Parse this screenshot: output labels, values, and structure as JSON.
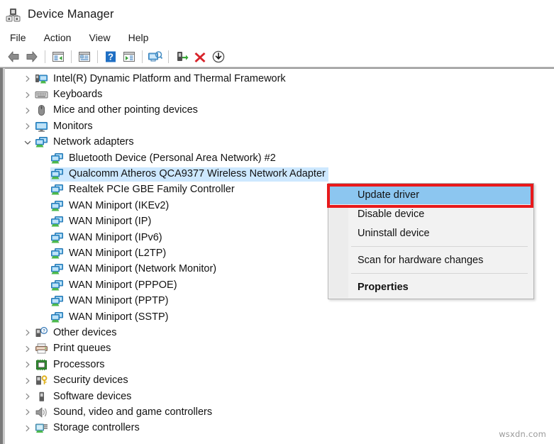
{
  "window": {
    "title": "Device Manager",
    "app_icon": "device-manager-icon"
  },
  "menubar": {
    "items": [
      {
        "label": "File",
        "name": "menu-file"
      },
      {
        "label": "Action",
        "name": "menu-action"
      },
      {
        "label": "View",
        "name": "menu-view"
      },
      {
        "label": "Help",
        "name": "menu-help"
      }
    ]
  },
  "toolbar": {
    "buttons": [
      {
        "icon": "back-arrow-icon",
        "title": "Back"
      },
      {
        "icon": "forward-arrow-icon",
        "title": "Forward"
      },
      {
        "icon": "up-one-level-icon",
        "title": "Up one level"
      },
      {
        "icon": "properties-icon",
        "title": "Properties"
      },
      {
        "icon": "help-icon",
        "title": "Help"
      },
      {
        "icon": "show-hidden-devices-icon",
        "title": "Show hidden devices"
      },
      {
        "icon": "scan-hardware-changes-icon",
        "title": "Scan for hardware changes"
      },
      {
        "icon": "enable-device-icon",
        "title": "Enable device"
      },
      {
        "icon": "uninstall-device-icon",
        "title": "Uninstall device"
      },
      {
        "icon": "update-driver-icon",
        "title": "Update driver"
      }
    ]
  },
  "tree": {
    "rows": [
      {
        "label": "Intel(R) Dynamic Platform and Thermal Framework",
        "level": 1,
        "chevron": "collapsed",
        "icon": "system-device-icon",
        "selected": false
      },
      {
        "label": "Keyboards",
        "level": 1,
        "chevron": "collapsed",
        "icon": "keyboard-icon",
        "selected": false
      },
      {
        "label": "Mice and other pointing devices",
        "level": 1,
        "chevron": "collapsed",
        "icon": "mouse-icon",
        "selected": false
      },
      {
        "label": "Monitors",
        "level": 1,
        "chevron": "collapsed",
        "icon": "monitor-icon",
        "selected": false
      },
      {
        "label": "Network adapters",
        "level": 1,
        "chevron": "expanded",
        "icon": "network-adapter-icon",
        "selected": false
      },
      {
        "label": "Bluetooth Device (Personal Area Network) #2",
        "level": 2,
        "chevron": "none",
        "icon": "network-adapter-icon",
        "selected": false
      },
      {
        "label": "Qualcomm Atheros QCA9377 Wireless Network Adapter",
        "level": 2,
        "chevron": "none",
        "icon": "network-adapter-icon",
        "selected": true
      },
      {
        "label": "Realtek PCIe GBE Family Controller",
        "level": 2,
        "chevron": "none",
        "icon": "network-adapter-icon",
        "selected": false
      },
      {
        "label": "WAN Miniport (IKEv2)",
        "level": 2,
        "chevron": "none",
        "icon": "network-adapter-icon",
        "selected": false
      },
      {
        "label": "WAN Miniport (IP)",
        "level": 2,
        "chevron": "none",
        "icon": "network-adapter-icon",
        "selected": false
      },
      {
        "label": "WAN Miniport (IPv6)",
        "level": 2,
        "chevron": "none",
        "icon": "network-adapter-icon",
        "selected": false
      },
      {
        "label": "WAN Miniport (L2TP)",
        "level": 2,
        "chevron": "none",
        "icon": "network-adapter-icon",
        "selected": false
      },
      {
        "label": "WAN Miniport (Network Monitor)",
        "level": 2,
        "chevron": "none",
        "icon": "network-adapter-icon",
        "selected": false
      },
      {
        "label": "WAN Miniport (PPPOE)",
        "level": 2,
        "chevron": "none",
        "icon": "network-adapter-icon",
        "selected": false
      },
      {
        "label": "WAN Miniport (PPTP)",
        "level": 2,
        "chevron": "none",
        "icon": "network-adapter-icon",
        "selected": false
      },
      {
        "label": "WAN Miniport (SSTP)",
        "level": 2,
        "chevron": "none",
        "icon": "network-adapter-icon",
        "selected": false
      },
      {
        "label": "Other devices",
        "level": 1,
        "chevron": "collapsed",
        "icon": "unknown-device-icon",
        "selected": false
      },
      {
        "label": "Print queues",
        "level": 1,
        "chevron": "collapsed",
        "icon": "printer-icon",
        "selected": false
      },
      {
        "label": "Processors",
        "level": 1,
        "chevron": "collapsed",
        "icon": "processor-icon",
        "selected": false
      },
      {
        "label": "Security devices",
        "level": 1,
        "chevron": "collapsed",
        "icon": "security-device-icon",
        "selected": false
      },
      {
        "label": "Software devices",
        "level": 1,
        "chevron": "collapsed",
        "icon": "software-device-icon",
        "selected": false
      },
      {
        "label": "Sound, video and game controllers",
        "level": 1,
        "chevron": "collapsed",
        "icon": "speaker-icon",
        "selected": false
      },
      {
        "label": "Storage controllers",
        "level": 1,
        "chevron": "collapsed",
        "icon": "storage-controller-icon",
        "selected": false
      }
    ]
  },
  "context_menu": {
    "items": [
      {
        "label": "Update driver",
        "type": "item",
        "highlighted": true,
        "bold": false,
        "name": "context-menu-update-driver"
      },
      {
        "label": "Disable device",
        "type": "item",
        "highlighted": false,
        "bold": false,
        "name": "context-menu-disable-device"
      },
      {
        "label": "Uninstall device",
        "type": "item",
        "highlighted": false,
        "bold": false,
        "name": "context-menu-uninstall-device"
      },
      {
        "type": "separator"
      },
      {
        "label": "Scan for hardware changes",
        "type": "item",
        "highlighted": false,
        "bold": false,
        "name": "context-menu-scan-for-hardware-changes"
      },
      {
        "type": "separator"
      },
      {
        "label": "Properties",
        "type": "item",
        "highlighted": false,
        "bold": true,
        "name": "context-menu-properties"
      }
    ]
  },
  "annotation": {
    "highlight_color": "#e8191b",
    "target": "Update driver"
  },
  "watermark": {
    "text": "wsxdn.com"
  },
  "colors": {
    "selection_blue": "#cde8ff",
    "menu_highlight_blue": "#8cc6f0",
    "annotation_red": "#e8191b",
    "window_bg": "#ffffff",
    "menu_bg": "#f2f2f2"
  }
}
